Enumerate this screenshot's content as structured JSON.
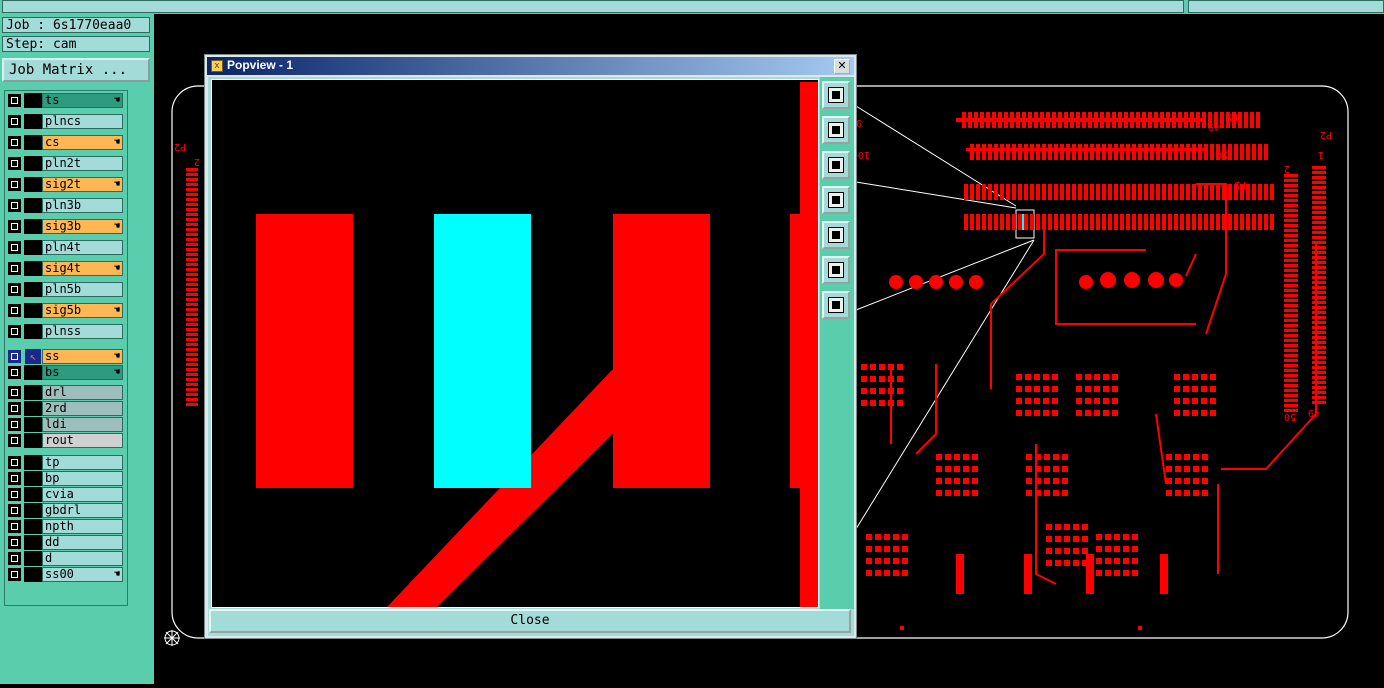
{
  "job_label": "Job : 6s1770eaa0",
  "step_label": "Step: cam",
  "matrix_button": "Job Matrix ...",
  "layers": [
    {
      "name": "ts",
      "color": "green",
      "hand": true
    },
    {
      "name": "plncs",
      "color": "default",
      "hand": false
    },
    {
      "name": "cs",
      "color": "orange",
      "hand": true
    },
    {
      "name": "pln2t",
      "color": "default",
      "hand": false
    },
    {
      "name": "sig2t",
      "color": "orange",
      "hand": true
    },
    {
      "name": "pln3b",
      "color": "default",
      "hand": false
    },
    {
      "name": "sig3b",
      "color": "orange",
      "hand": true
    },
    {
      "name": "pln4t",
      "color": "default",
      "hand": false
    },
    {
      "name": "sig4t",
      "color": "orange",
      "hand": true
    },
    {
      "name": "pln5b",
      "color": "default",
      "hand": false
    },
    {
      "name": "sig5b",
      "color": "orange",
      "hand": true
    },
    {
      "name": "plnss",
      "color": "default",
      "hand": false
    },
    {
      "name": "ss",
      "color": "orange",
      "hand": true
    },
    {
      "name": "bs",
      "color": "green",
      "hand": true
    },
    {
      "name": "drl",
      "color": "gray",
      "hand": false
    },
    {
      "name": "2rd",
      "color": "gray",
      "hand": false
    },
    {
      "name": "ldi",
      "color": "gray",
      "hand": false
    },
    {
      "name": "rout",
      "color": "lgray",
      "hand": false
    },
    {
      "name": "tp",
      "color": "default",
      "hand": false
    },
    {
      "name": "bp",
      "color": "default",
      "hand": false
    },
    {
      "name": "cvia",
      "color": "default",
      "hand": false
    },
    {
      "name": "gbdrl",
      "color": "default",
      "hand": false
    },
    {
      "name": "npth",
      "color": "default",
      "hand": false
    },
    {
      "name": "dd",
      "color": "default",
      "hand": false
    },
    {
      "name": "d",
      "color": "default",
      "hand": false
    },
    {
      "name": "ss00",
      "color": "default",
      "hand": true
    }
  ],
  "popview": {
    "title": "Popview - 1",
    "close_label": "Close",
    "tools": [
      "zoom-window-icon",
      "zoom-in-icon",
      "zoom-out-icon",
      "pan-left-icon",
      "pan-right-icon",
      "zoom-fit-icon",
      "pan-center-icon"
    ]
  },
  "board_labels": {
    "p2_left": "P2",
    "p2_right": "P2",
    "p5a": "P5",
    "p5b": "P5",
    "n2a": "2",
    "n2b": "2",
    "n1": "1",
    "n49": "49",
    "n50": "50",
    "n99": "99",
    "n100": "100",
    "n50r": "50",
    "n49r": "49"
  },
  "colors": {
    "trace": "#ff0000",
    "highlight": "#00ffff",
    "panel": "#5acdac",
    "field": "#a3dbd9",
    "orange": "#ffb654",
    "green": "#2e9b7e"
  }
}
